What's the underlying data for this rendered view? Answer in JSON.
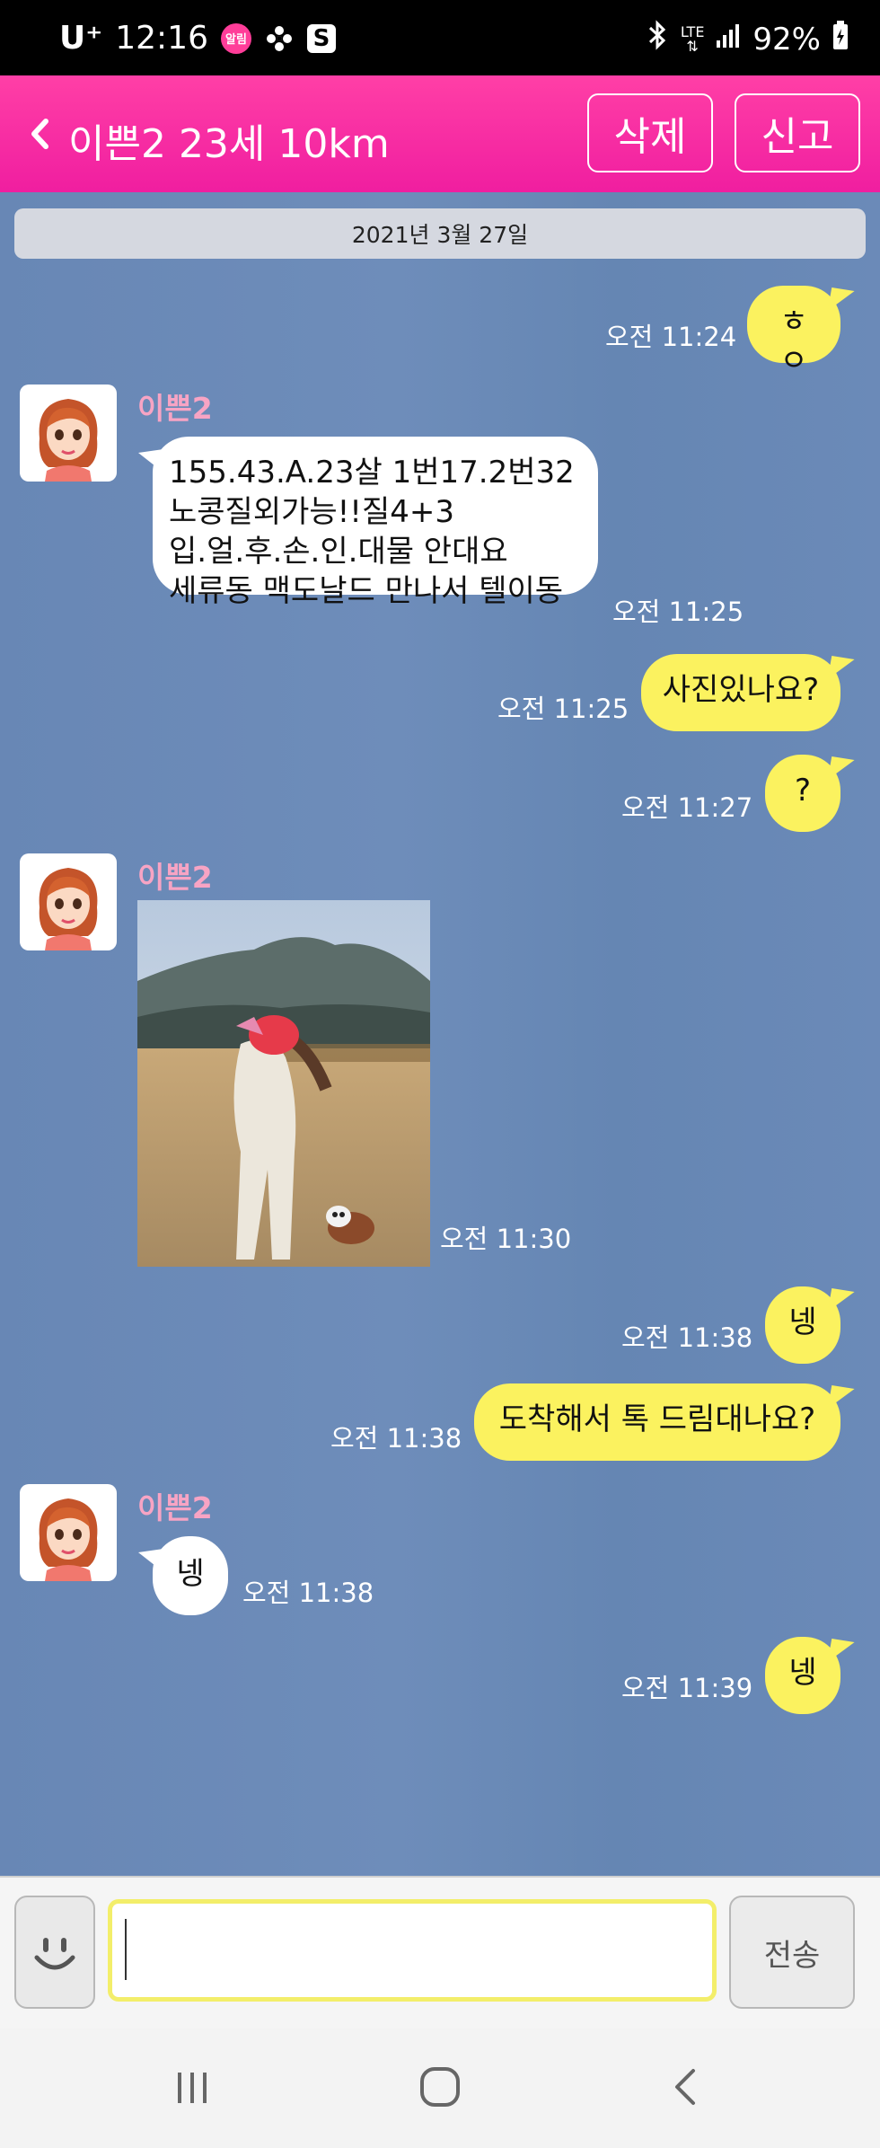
{
  "status_bar": {
    "carrier": "U⁺",
    "time": "12:16",
    "notif_badge": "알림",
    "battery": "92%",
    "network": "LTE"
  },
  "header": {
    "title": "이쁜2 23세 10km",
    "delete_label": "삭제",
    "report_label": "신고"
  },
  "chat": {
    "date": "2021년 3월 27일",
    "sender_name": "이쁜2",
    "messages": [
      {
        "from": "me",
        "text": "ㅎㅇ",
        "time": "오전 11:24"
      },
      {
        "from": "them",
        "lines": [
          "155.43.A.23살 1번17.2번32",
          "노콩질외가능!!질4+3",
          "입.얼.후.손.인.대물 안대요",
          "세류동 맥도날드 만나서 텔이동"
        ],
        "time": "오전 11:25"
      },
      {
        "from": "me",
        "text": "사진있나요?",
        "time": "오전 11:25"
      },
      {
        "from": "me",
        "text": "?",
        "time": "오전 11:27"
      },
      {
        "from": "them",
        "type": "photo",
        "time": "오전 11:30"
      },
      {
        "from": "me",
        "text": "넹",
        "time": "오전 11:38"
      },
      {
        "from": "me",
        "text": "도착해서 톡 드림대나요?",
        "time": "오전 11:38"
      },
      {
        "from": "them",
        "text": "넹",
        "time": "오전 11:38"
      },
      {
        "from": "me",
        "text": "넹",
        "time": "오전 11:39"
      }
    ]
  },
  "input_bar": {
    "placeholder": "",
    "send_label": "전송"
  },
  "colors": {
    "header": "#f52aa3",
    "chat_bg": "#6887b5",
    "my_bubble": "#fbf25f",
    "their_bubble": "#ffffff",
    "sender_name": "#f7a4c4"
  }
}
